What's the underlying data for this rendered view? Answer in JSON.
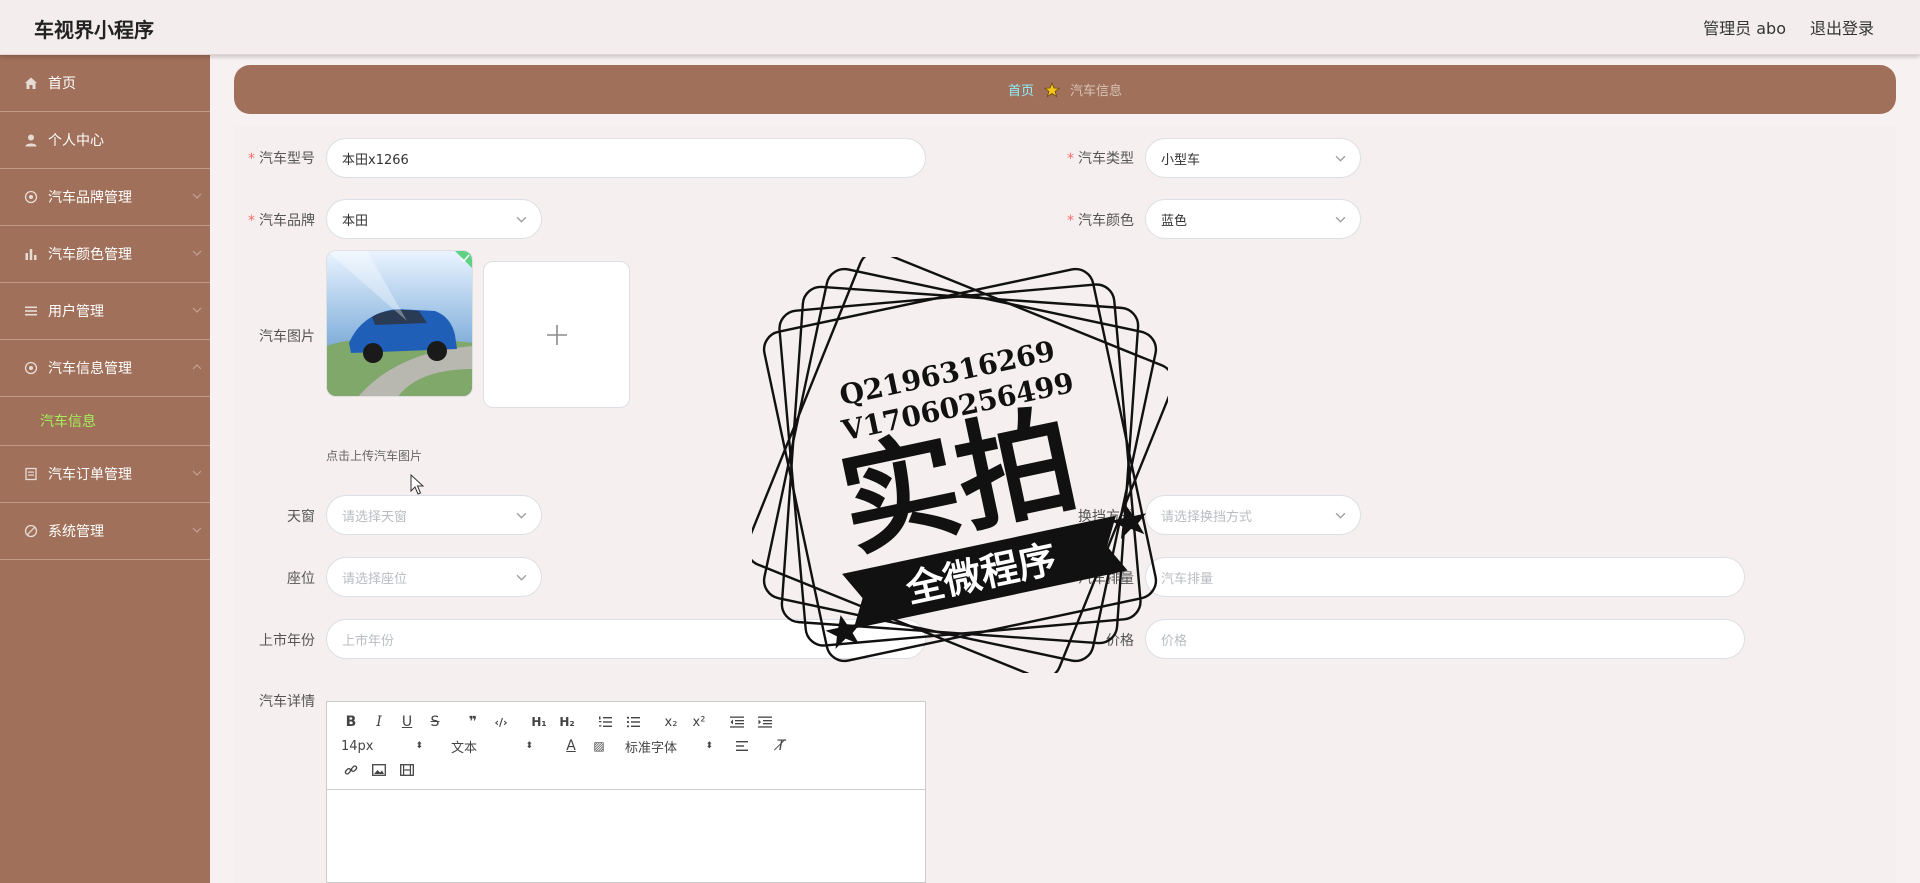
{
  "header": {
    "app_title": "车视界小程序",
    "admin_label": "管理员 abo",
    "logout_label": "退出登录"
  },
  "sidebar": {
    "items": [
      {
        "label": "首页",
        "icon": "home-icon"
      },
      {
        "label": "个人中心",
        "icon": "user-icon"
      },
      {
        "label": "汽车品牌管理",
        "icon": "settings-icon"
      },
      {
        "label": "汽车颜色管理",
        "icon": "bar-chart-icon"
      },
      {
        "label": "用户管理",
        "icon": "menu-icon"
      },
      {
        "label": "汽车信息管理",
        "icon": "settings-icon"
      },
      {
        "label": "汽车订单管理",
        "icon": "document-icon"
      },
      {
        "label": "系统管理",
        "icon": "circle-slash-icon"
      }
    ],
    "submenu": {
      "label": "汽车信息"
    }
  },
  "breadcrumb": {
    "home": "首页",
    "current": "汽车信息"
  },
  "form": {
    "model": {
      "label": "汽车型号",
      "value": "本田x1266"
    },
    "type": {
      "label": "汽车类型",
      "value": "小型车"
    },
    "brand": {
      "label": "汽车品牌",
      "value": "本田"
    },
    "color": {
      "label": "汽车颜色",
      "value": "蓝色"
    },
    "image": {
      "label": "汽车图片",
      "tip": "点击上传汽车图片"
    },
    "sunroof": {
      "label": "天窗",
      "placeholder": "请选择天窗"
    },
    "gearshift": {
      "label": "换挡方式",
      "placeholder": "请选择换挡方式"
    },
    "seat": {
      "label": "座位",
      "placeholder": "请选择座位"
    },
    "displacement": {
      "label": "汽车排量",
      "placeholder": "汽车排量"
    },
    "year": {
      "label": "上市年份",
      "placeholder": "上市年份"
    },
    "price": {
      "label": "价格",
      "placeholder": "价格"
    },
    "detail": {
      "label": "汽车详情"
    }
  },
  "editor": {
    "font_size": "14px",
    "format": "文本",
    "font_family": "标准字体"
  },
  "watermark": {
    "line1": "Q2196316269",
    "line2": "V17060256499",
    "main": "实拍",
    "ribbon": "全微程序"
  },
  "colors": {
    "sidebar": "#a0705a",
    "accent_submenu": "#a6ed5a",
    "required": "#f56c6c"
  }
}
